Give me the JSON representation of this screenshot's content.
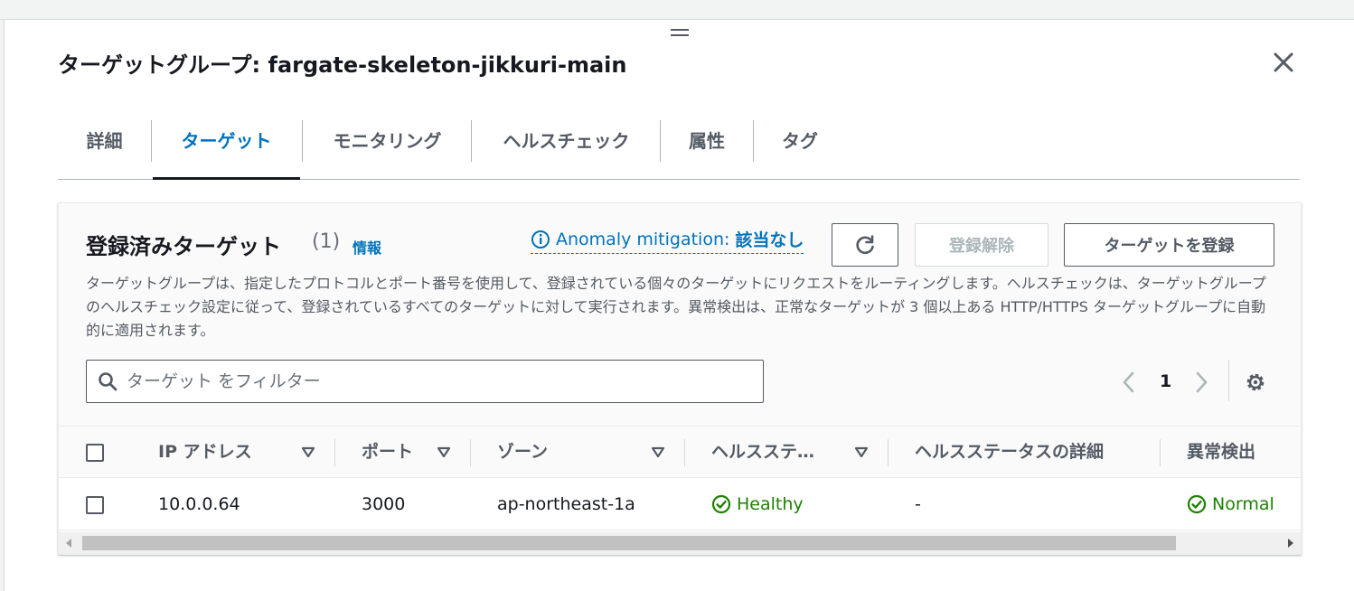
{
  "header": {
    "title": "ターゲットグループ: fargate-skeleton-jikkuri-main",
    "close_icon": "close-icon"
  },
  "tabs": [
    {
      "label": "詳細",
      "active": false
    },
    {
      "label": "ターゲット",
      "active": true
    },
    {
      "label": "モニタリング",
      "active": false
    },
    {
      "label": "ヘルスチェック",
      "active": false
    },
    {
      "label": "属性",
      "active": false
    },
    {
      "label": "タグ",
      "active": false
    }
  ],
  "targets_panel": {
    "title": "登録済みターゲット",
    "count": "(1)",
    "info_link": "情報",
    "anomaly_label": "Anomaly mitigation:",
    "anomaly_value": "該当なし",
    "refresh_icon": "refresh-icon",
    "deregister_label": "登録解除",
    "register_label": "ターゲットを登録",
    "description": "ターゲットグループは、指定したプロトコルとポート番号を使用して、登録されている個々のターゲットにリクエストをルーティングします。ヘルスチェックは、ターゲットグループのヘルスチェック設定に従って、登録されているすべてのターゲットに対して実行されます。異常検出は、正常なターゲットが 3 個以上ある HTTP/HTTPS ターゲットグループに自動的に適用されます。"
  },
  "filter": {
    "placeholder": "ターゲット をフィルター",
    "value": ""
  },
  "pagination": {
    "current_page": "1"
  },
  "table": {
    "columns": [
      "IP アドレス",
      "ポート",
      "ゾーン",
      "ヘルスステ…",
      "ヘルスステータスの詳細",
      "異常検出"
    ],
    "rows": [
      {
        "ip": "10.0.0.64",
        "port": "3000",
        "zone": "ap-northeast-1a",
        "health": "Healthy",
        "health_detail": "-",
        "anomaly": "Normal"
      }
    ]
  },
  "colors": {
    "accent": "#0073bb",
    "healthy": "#1d8102",
    "text": "#16191f",
    "muted": "#545b64"
  }
}
